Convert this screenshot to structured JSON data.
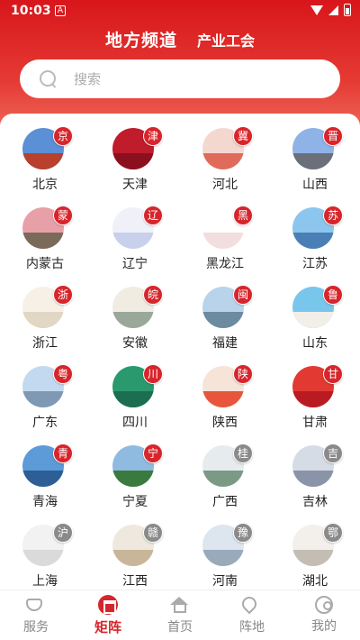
{
  "status": {
    "time": "10:03",
    "a": "A"
  },
  "header": {
    "title": "地方频道",
    "subtitle": "产业工会"
  },
  "search": {
    "placeholder": "搜索"
  },
  "regions": [
    {
      "name": "北京",
      "badge": "京",
      "sky": "#5b8fd6",
      "ground": "#b8402c",
      "badge_color": "red"
    },
    {
      "name": "天津",
      "badge": "津",
      "sky": "#c01c2c",
      "ground": "#8a1020",
      "badge_color": "red"
    },
    {
      "name": "河北",
      "badge": "冀",
      "sky": "#f4d7cf",
      "ground": "#e06b5b",
      "badge_color": "red"
    },
    {
      "name": "山西",
      "badge": "晋",
      "sky": "#8fb3e6",
      "ground": "#6a6f7a",
      "badge_color": "red"
    },
    {
      "name": "内蒙古",
      "badge": "蒙",
      "sky": "#e8a0a8",
      "ground": "#7a6a5a",
      "badge_color": "red"
    },
    {
      "name": "辽宁",
      "badge": "辽",
      "sky": "#f0f0f8",
      "ground": "#c8d0ec",
      "badge_color": "red"
    },
    {
      "name": "黑龙江",
      "badge": "黑",
      "sky": "#ffffff",
      "ground": "#f2dede",
      "badge_color": "red"
    },
    {
      "name": "江苏",
      "badge": "苏",
      "sky": "#8cc6ee",
      "ground": "#4a7fb5",
      "badge_color": "red"
    },
    {
      "name": "浙江",
      "badge": "浙",
      "sky": "#f6f0e6",
      "ground": "#e2d6c4",
      "badge_color": "red"
    },
    {
      "name": "安徽",
      "badge": "皖",
      "sky": "#f1ece2",
      "ground": "#9aa89a",
      "badge_color": "red"
    },
    {
      "name": "福建",
      "badge": "闽",
      "sky": "#b9d4ea",
      "ground": "#6c8aa0",
      "badge_color": "red"
    },
    {
      "name": "山东",
      "badge": "鲁",
      "sky": "#79c6ec",
      "ground": "#f2eee8",
      "badge_color": "red"
    },
    {
      "name": "广东",
      "badge": "粤",
      "sky": "#c3d9ef",
      "ground": "#7f99b5",
      "badge_color": "red"
    },
    {
      "name": "四川",
      "badge": "川",
      "sky": "#2a9a6e",
      "ground": "#1c6e50",
      "badge_color": "red"
    },
    {
      "name": "陕西",
      "badge": "陕",
      "sky": "#f6e4d8",
      "ground": "#e8553d",
      "badge_color": "red"
    },
    {
      "name": "甘肃",
      "badge": "甘",
      "sky": "#e23a32",
      "ground": "#b81c22",
      "badge_color": "red"
    },
    {
      "name": "青海",
      "badge": "青",
      "sky": "#5d9ad8",
      "ground": "#2d5f96",
      "badge_color": "red"
    },
    {
      "name": "宁夏",
      "badge": "宁",
      "sky": "#8fbbe0",
      "ground": "#3a7a3e",
      "badge_color": "red"
    },
    {
      "name": "广西",
      "badge": "桂",
      "sky": "#e6ecee",
      "ground": "#7a9a86",
      "badge_color": "grey"
    },
    {
      "name": "吉林",
      "badge": "吉",
      "sky": "#d6dce6",
      "ground": "#8a94a8",
      "badge_color": "grey"
    },
    {
      "name": "上海",
      "badge": "沪",
      "sky": "#f2f2f2",
      "ground": "#dadada",
      "badge_color": "grey"
    },
    {
      "name": "江西",
      "badge": "赣",
      "sky": "#efe8df",
      "ground": "#c9b69a",
      "badge_color": "grey"
    },
    {
      "name": "河南",
      "badge": "豫",
      "sky": "#dde6ee",
      "ground": "#9aaabb",
      "badge_color": "grey"
    },
    {
      "name": "湖北",
      "badge": "鄂",
      "sky": "#f3f0ec",
      "ground": "#c4bdb4",
      "badge_color": "grey"
    }
  ],
  "tabs": [
    {
      "label": "服务",
      "icon": "service-icon",
      "active": false
    },
    {
      "label": "矩阵",
      "icon": "matrix-icon",
      "active": true
    },
    {
      "label": "首页",
      "icon": "home-icon",
      "active": false
    },
    {
      "label": "阵地",
      "icon": "location-icon",
      "active": false
    },
    {
      "label": "我的",
      "icon": "profile-icon",
      "active": false
    }
  ],
  "colors": {
    "brand": "#d7252b",
    "header_top": "#d8161b",
    "badge_grey": "#8a8a8a"
  }
}
